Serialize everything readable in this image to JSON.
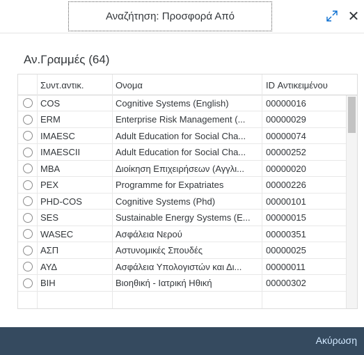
{
  "dialog": {
    "title": "Αναζήτηση: Προσφορά Από",
    "expand_icon": "expand-icon",
    "close_icon": "close-icon",
    "close_symbol": "✕",
    "expand_symbol": "⤢"
  },
  "list": {
    "heading": "Αν.Γραμμές (64)",
    "columns": [
      "Συντ.αντικ.",
      "Ονομα",
      "ID Αντικειμένου"
    ],
    "rows": [
      {
        "code": "COS",
        "name": "Cognitive Systems (English)",
        "id": "00000016"
      },
      {
        "code": "ERM",
        "name": "Enterprise Risk Management (...",
        "id": "00000029"
      },
      {
        "code": "IMAESC",
        "name": "Adult Education for Social Cha...",
        "id": "00000074"
      },
      {
        "code": "IMAESCII",
        "name": "Adult Education for Social Cha...",
        "id": "00000252"
      },
      {
        "code": "MBA",
        "name": "Διοίκηση Επιχειρήσεων (Αγγλι...",
        "id": "00000020"
      },
      {
        "code": "PEX",
        "name": "Programme for Expatriates",
        "id": "00000226"
      },
      {
        "code": "PHD-COS",
        "name": "Cognitive Systems (Phd)",
        "id": "00000101"
      },
      {
        "code": "SES",
        "name": "Sustainable Energy Systems (E...",
        "id": "00000015"
      },
      {
        "code": "WASEC",
        "name": "Ασφάλεια Νερού",
        "id": "00000351"
      },
      {
        "code": "ΑΣΠ",
        "name": "Αστυνομικές Σπουδές",
        "id": "00000025"
      },
      {
        "code": "ΑΥΔ",
        "name": "Ασφάλεια Υπολογιστών και Δι...",
        "id": "00000011"
      },
      {
        "code": "ΒΙΗ",
        "name": "Βιοηθική - Ιατρική Ηθική",
        "id": "00000302"
      }
    ]
  },
  "footer": {
    "cancel_label": "Ακύρωση"
  },
  "colors": {
    "footer_bg": "#354a5f",
    "accent": "#0a6ed1"
  }
}
